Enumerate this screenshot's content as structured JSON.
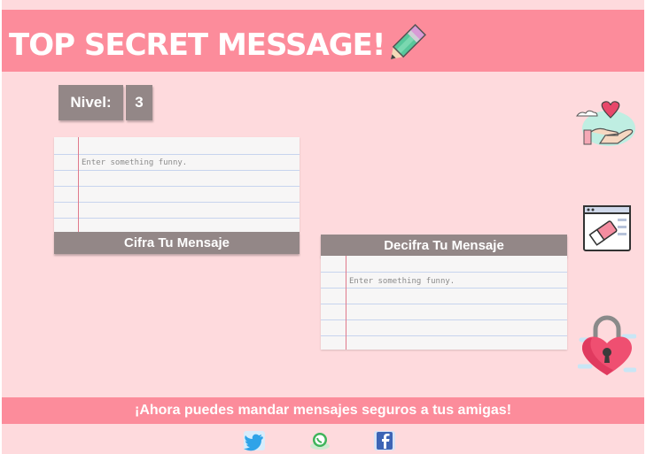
{
  "header": {
    "title": "TOP SECRET MESSAGE!"
  },
  "level": {
    "label": "Nivel:",
    "value": "3"
  },
  "encrypt": {
    "placeholder": "Enter something funny.",
    "button_label": "Cifra Tu Mensaje"
  },
  "decrypt": {
    "placeholder": "Enter something funny.",
    "button_label": "Decifra Tu Mensaje"
  },
  "footer": {
    "tagline": "¡Ahora puedes mandar mensajes seguros a tus amigas!"
  },
  "icons": {
    "pencil": "pencil-icon",
    "hand_heart": "hand-heart-icon",
    "eraser_window": "eraser-window-icon",
    "heart_lock": "heart-lock-icon",
    "social": [
      "twitter-icon",
      "whatsapp-icon",
      "facebook-icon"
    ]
  },
  "colors": {
    "background": "#fedadd",
    "header": "#fc8c9b",
    "button": "#938787",
    "text_light": "#ffffff"
  }
}
